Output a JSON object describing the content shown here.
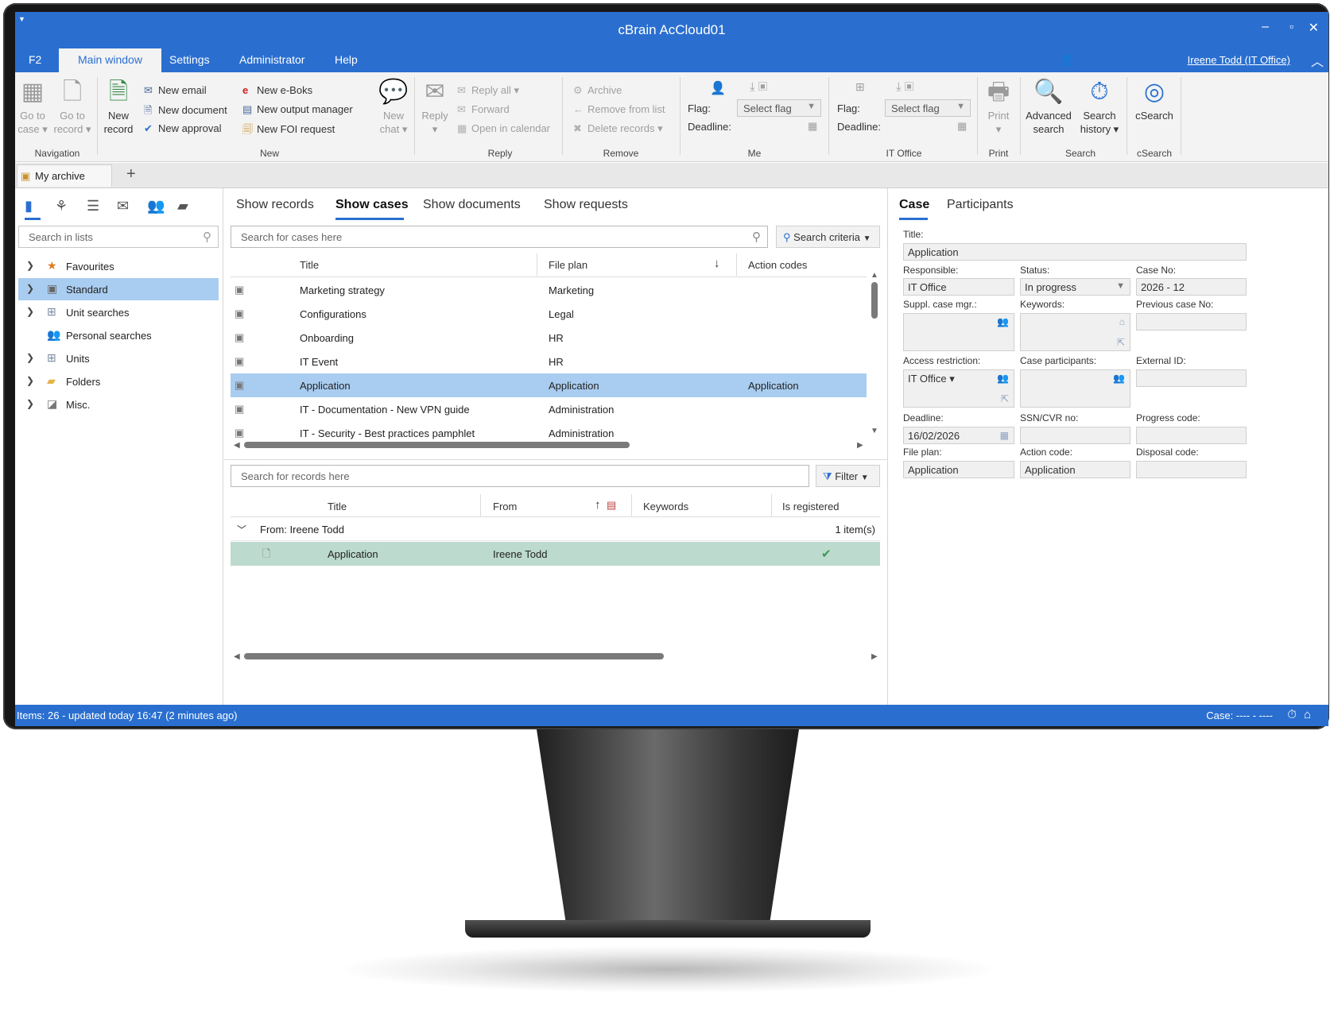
{
  "window": {
    "title": "cBrain AcCloud01",
    "controls": {
      "minimize": "–",
      "maximize": "▫",
      "close": "✕"
    }
  },
  "menu": {
    "f2": "F2",
    "items": [
      "Main window",
      "Settings",
      "Administrator",
      "Help"
    ],
    "user": "Ireene Todd (IT Office)"
  },
  "ribbon": {
    "navigation": {
      "go_to_case": "Go to",
      "go_to_case_2": "case ▾",
      "go_to_record": "Go to",
      "go_to_record_2": "record ▾",
      "label": "Navigation"
    },
    "new": {
      "new_record_1": "New",
      "new_record_2": "record",
      "new_email": "New email",
      "new_document": "New document",
      "new_approval": "New approval",
      "new_eboks": "New e-Boks",
      "new_output_manager": "New output manager",
      "new_foi": "New FOI request",
      "new_chat_1": "New",
      "new_chat_2": "chat ▾",
      "label": "New"
    },
    "reply": {
      "reply": "Reply",
      "reply_arrow": "▾",
      "reply_all": "Reply all ▾",
      "forward": "Forward",
      "open_calendar": "Open in calendar",
      "label": "Reply"
    },
    "remove": {
      "archive": "Archive",
      "remove_from_list": "Remove from list",
      "delete_records": "Delete records ▾",
      "label": "Remove"
    },
    "me": {
      "flag": "Flag:",
      "deadline": "Deadline:",
      "select_flag": "Select flag",
      "label": "Me"
    },
    "it_office": {
      "flag": "Flag:",
      "deadline": "Deadline:",
      "select_flag": "Select flag",
      "label": "IT Office"
    },
    "print": {
      "print": "Print",
      "print_arrow": "▾",
      "label": "Print"
    },
    "search": {
      "advanced_1": "Advanced",
      "advanced_2": "search",
      "history_1": "Search",
      "history_2": "history ▾",
      "label": "Search"
    },
    "csearch": {
      "csearch": "cSearch",
      "label": "cSearch"
    }
  },
  "doc_tabs": {
    "my_archive": "My archive",
    "add": "+"
  },
  "left": {
    "search_placeholder": "Search in lists",
    "tree": [
      {
        "label": "Favourites",
        "icon": "star-icon"
      },
      {
        "label": "Standard",
        "icon": "list-icon"
      },
      {
        "label": "Unit searches",
        "icon": "unit-icon"
      },
      {
        "label": "Personal searches",
        "icon": "people-icon"
      },
      {
        "label": "Units",
        "icon": "unit-icon"
      },
      {
        "label": "Folders",
        "icon": "folder-icon"
      },
      {
        "label": "Misc.",
        "icon": "misc-icon"
      }
    ]
  },
  "middle": {
    "tabs": [
      "Show records",
      "Show cases",
      "Show documents",
      "Show requests"
    ],
    "case_search_placeholder": "Search for cases here",
    "search_criteria": "Search criteria",
    "case_columns": [
      "Title",
      "File plan",
      "Action codes"
    ],
    "cases": [
      {
        "title": "Marketing strategy",
        "file_plan": "Marketing",
        "action_codes": ""
      },
      {
        "title": "Configurations",
        "file_plan": "Legal",
        "action_codes": ""
      },
      {
        "title": "Onboarding",
        "file_plan": "HR",
        "action_codes": ""
      },
      {
        "title": "IT Event",
        "file_plan": "HR",
        "action_codes": ""
      },
      {
        "title": "Application",
        "file_plan": "Application",
        "action_codes": "Application"
      },
      {
        "title": "IT - Documentation - New VPN guide",
        "file_plan": "Administration",
        "action_codes": ""
      },
      {
        "title": "IT - Security - Best practices pamphlet",
        "file_plan": "Administration",
        "action_codes": ""
      }
    ],
    "selected_case_index": 4,
    "record_search_placeholder": "Search for records here",
    "filter": "Filter",
    "record_columns": [
      "Title",
      "From",
      "Keywords",
      "Is registered"
    ],
    "group": {
      "label": "From:  Ireene Todd",
      "count": "1 item(s)"
    },
    "records": [
      {
        "title": "Application",
        "from": "Ireene Todd",
        "keywords": "",
        "registered": "✔"
      }
    ]
  },
  "right": {
    "tabs": [
      "Case",
      "Participants"
    ],
    "labels": {
      "title": "Title:",
      "responsible": "Responsible:",
      "status": "Status:",
      "case_no": "Case No:",
      "suppl": "Suppl. case mgr.:",
      "keywords": "Keywords:",
      "previous": "Previous case No:",
      "access": "Access restriction:",
      "participants": "Case participants:",
      "external": "External ID:",
      "deadline": "Deadline:",
      "ssn": "SSN/CVR no:",
      "progress": "Progress code:",
      "file_plan": "File plan:",
      "action_code": "Action code:",
      "disposal": "Disposal code:"
    },
    "values": {
      "title": "Application",
      "responsible": "IT Office",
      "status": "In progress",
      "case_no": "2026 - 12",
      "access": "IT Office ▾",
      "deadline": "16/02/2026",
      "file_plan": "Application",
      "action_code": "Application"
    }
  },
  "status": {
    "left": "Items: 26 - updated today 16:47 (2 minutes ago)",
    "right": "Case: ---- - ----"
  },
  "colors": {
    "accent": "#2a6fd0",
    "selection": "#a9cdf0",
    "record_selection": "#bcdacd"
  }
}
